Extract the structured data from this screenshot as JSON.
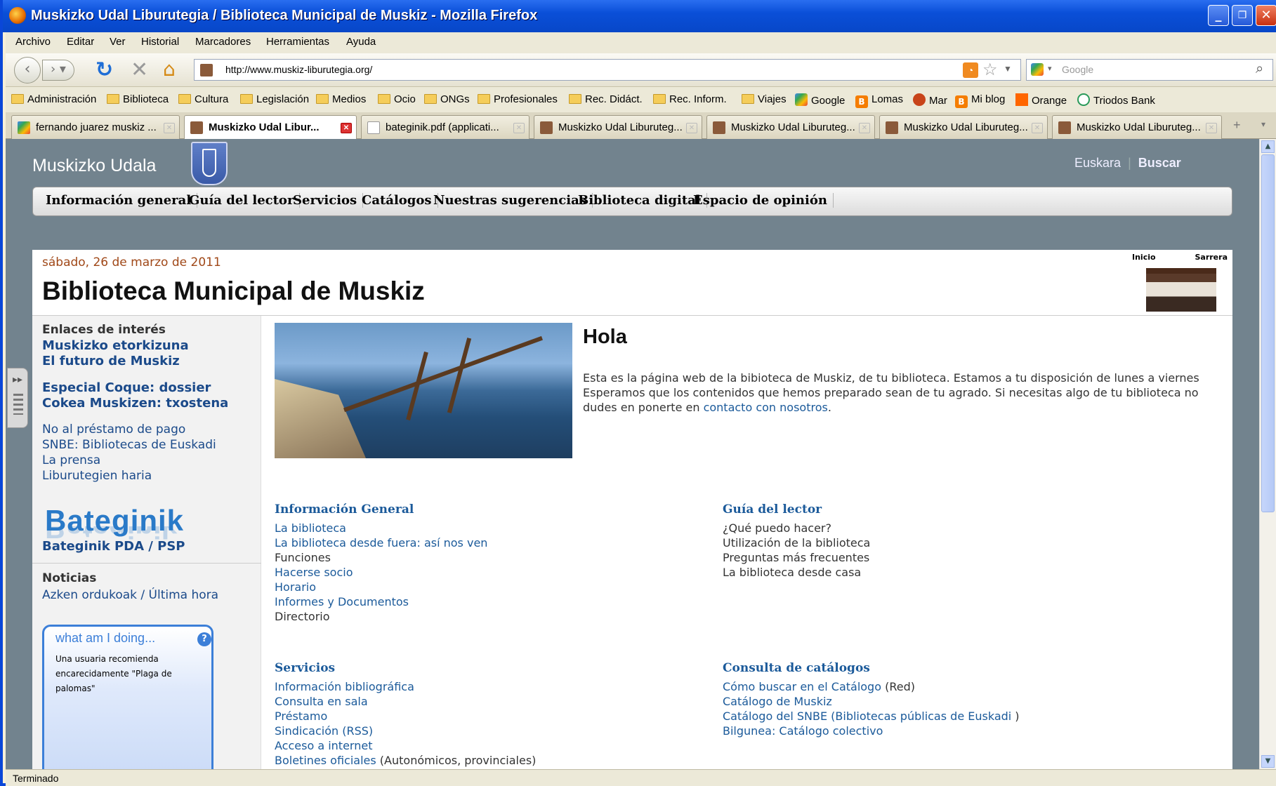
{
  "window": {
    "title": "Muskizko Udal Liburutegia / Biblioteca Municipal de Muskiz - Mozilla Firefox"
  },
  "menu": [
    "Archivo",
    "Editar",
    "Ver",
    "Historial",
    "Marcadores",
    "Herramientas",
    "Ayuda"
  ],
  "toolbar": {
    "url": "http://www.muskiz-liburutegia.org/",
    "search_placeholder": "Google"
  },
  "bookmarks": [
    "Administración",
    "Biblioteca",
    "Cultura",
    "Legislación",
    "Medios",
    "Ocio",
    "ONGs",
    "Profesionales",
    "Rec. Didáct.",
    "Rec. Inform.",
    "Viajes",
    "Google",
    "Lomas",
    "Mar",
    "Mi blog",
    "Orange",
    "Triodos Bank"
  ],
  "tabs": [
    "fernando juarez muskiz ...",
    "Muskizko Udal Libur...",
    "bateginik.pdf (applicati...",
    "Muskizko Udal Liburuteg...",
    "Muskizko Udal Liburuteg...",
    "Muskizko Udal Liburuteg...",
    "Muskizko Udal Liburuteg..."
  ],
  "site": {
    "name": "Muskizko Udala",
    "lang": "Euskara",
    "search": "Buscar"
  },
  "nav": [
    "Información general",
    "Guía del lector",
    "Servicios",
    "Catálogos",
    "Nuestras sugerencias",
    "Biblioteca digital",
    "Espacio de opinión"
  ],
  "page": {
    "date": "sábado, 26 de marzo de 2011",
    "title": "Biblioteca Municipal de Muskiz",
    "logo_left": "Inicio",
    "logo_right": "Sarrera",
    "greeting": "Hola",
    "intro_text": "Esta es la página web de la bibioteca de Muskiz, de tu biblioteca. Estamos a tu disposición de lunes a viernes Esperamos que los contenidos que hemos preparado sean de tu agrado. Si necesitas algo de tu biblioteca no dudes en ponerte en ",
    "intro_link": "contacto con nosotros",
    "intro_end": "."
  },
  "sidebar": {
    "links_head": "Enlaces de interés",
    "bold_links": [
      "Muskizko etorkizuna",
      "El futuro de Muskiz",
      "Especial Coque: dossier",
      "Cokea Muskizen: txostena"
    ],
    "links": [
      "No al préstamo de pago",
      "SNBE: Bibliotecas de Euskadi",
      "La prensa",
      "Liburutegien haria"
    ],
    "bateginik": "Bateginik",
    "pda": "Bateginik PDA / PSP",
    "news_head": "Noticias",
    "news_link": "Azken ordukoak / Última hora",
    "widget_title": "what am I doing...",
    "widget_q": "?",
    "widget_text": "Una usuaria recomienda encarecidamente \"Plaga de palomas\""
  },
  "sections": {
    "info": {
      "head": "Información General",
      "items": [
        "La biblioteca",
        "La biblioteca desde fuera: así nos ven",
        "Funciones",
        "Hacerse socio",
        "Horario",
        "Informes y Documentos",
        "Directorio"
      ]
    },
    "guia": {
      "head": "Guía del lector",
      "items": [
        "¿Qué puedo hacer?",
        "Utilización de la biblioteca",
        "Preguntas más frecuentes",
        "La biblioteca desde casa"
      ]
    },
    "servicios": {
      "head": "Servicios",
      "items": [
        "Información bibliográfica",
        "Consulta en sala",
        "Préstamo",
        "Sindicación (RSS)",
        "Acceso a internet",
        "Boletines oficiales"
      ],
      "last_suffix": " (Autonómicos, provinciales)"
    },
    "catalogos": {
      "head": "Consulta de catálogos",
      "items": [
        "Cómo buscar en el Catálogo",
        "Catálogo de Muskiz",
        "Catálogo del SNBE (Bibliotecas públicas de Euskadi",
        "Bilgunea: Catálogo colectivo"
      ],
      "suffix_0": " (Red)",
      "suffix_2": " )"
    }
  },
  "status": "Terminado"
}
